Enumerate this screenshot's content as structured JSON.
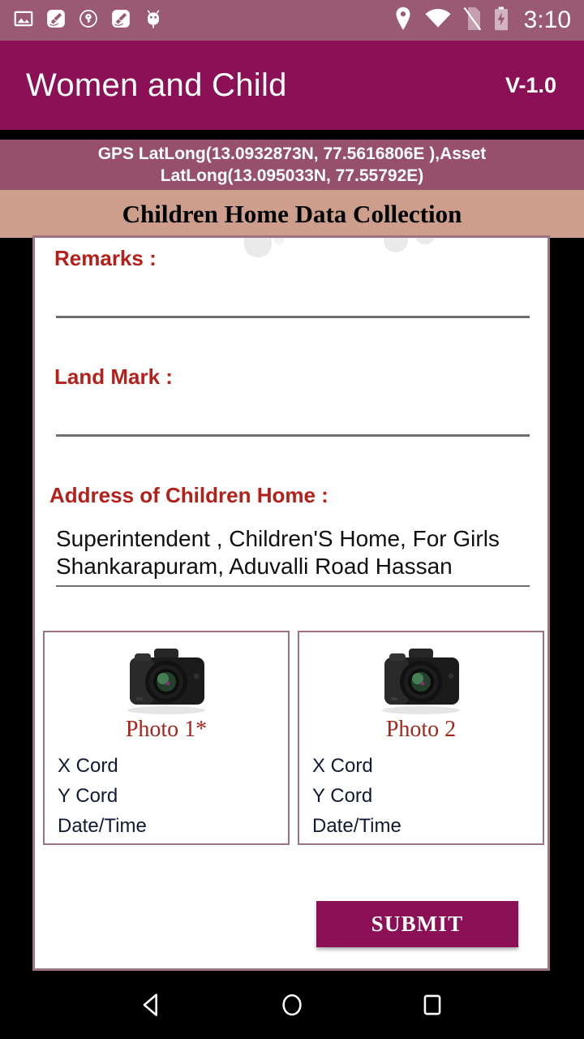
{
  "status_bar": {
    "time": "3:10",
    "left_icons": [
      "image-icon",
      "cleaner-icon",
      "shield-key-icon",
      "cleaner-icon",
      "android-bug-icon"
    ],
    "right_icons": [
      "location-pin-icon",
      "wifi-icon",
      "no-sim-icon",
      "battery-charging-icon"
    ],
    "background": "#9B5A73"
  },
  "app_bar": {
    "title": "Women and Child",
    "version": "V-1.0",
    "background": "#8B1055"
  },
  "gps_band": {
    "text": "GPS LatLong(13.0932873N, 77.5616806E ),Asset LatLong(13.095033N, 77.55792E)",
    "background": "#96506C"
  },
  "section": {
    "title": "Children Home Data Collection",
    "background": "#CC9E8B"
  },
  "form": {
    "label_color": "#B5211A",
    "fields": [
      {
        "label": "Remarks  :",
        "value": "",
        "placeholder": ""
      },
      {
        "label": "Land Mark  :",
        "value": "",
        "placeholder": ""
      }
    ],
    "address": {
      "label": "Address of Children Home :",
      "value": "Superintendent , Children'S Home, For Girls Shankarapuram, Aduvalli Road Hassan"
    }
  },
  "photos": [
    {
      "caption": "Photo 1*",
      "icon": "camera-icon",
      "coords": [
        "X Cord",
        "Y Cord",
        "Date/Time"
      ]
    },
    {
      "caption": "Photo 2",
      "icon": "camera-icon",
      "coords": [
        "X Cord",
        "Y Cord",
        "Date/Time"
      ]
    }
  ],
  "actions": {
    "submit_label": "SUBMIT",
    "submit_color": "#8B1055"
  },
  "nav_bar": {
    "buttons": [
      "back-nav-button",
      "home-nav-button",
      "recents-nav-button"
    ]
  }
}
